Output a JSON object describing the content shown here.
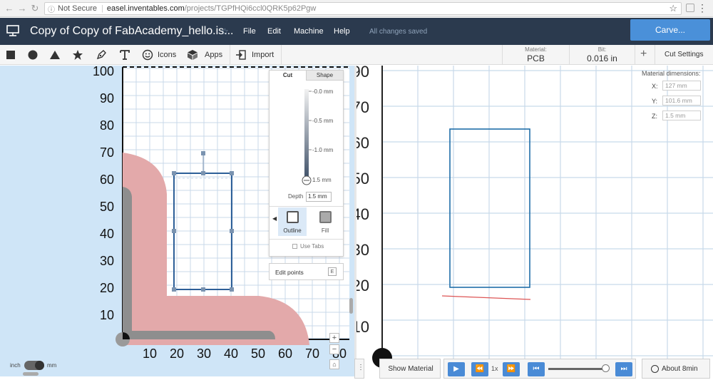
{
  "browser": {
    "security": "Not Secure",
    "host": "easel.inventables.com",
    "path": "/projects/TGPfHQi6ccl0QRK5p62Pgw"
  },
  "app": {
    "title": "Copy of Copy of FabAcademy_hello.is...",
    "menu": [
      "File",
      "Edit",
      "Machine",
      "Help"
    ],
    "save_status": "All changes saved",
    "carve_label": "Carve..."
  },
  "toolbar": {
    "icons_label": "Icons",
    "apps_label": "Apps",
    "import_label": "Import",
    "material_label": "Material:",
    "material_value": "PCB",
    "bit_label": "Bit:",
    "bit_value": "0.016 in",
    "cut_settings_label": "Cut Settings"
  },
  "left_canvas": {
    "y_ticks": [
      "100",
      "90",
      "80",
      "70",
      "60",
      "50",
      "40",
      "30",
      "20",
      "10"
    ],
    "x_ticks": [
      "10",
      "20",
      "30",
      "40",
      "50",
      "60",
      "70",
      "80"
    ],
    "unit_inch": "inch",
    "unit_mm": "mm"
  },
  "cut_panel": {
    "tab_cut": "Cut",
    "tab_shape": "Shape",
    "depth_marks": [
      "-0.0 mm",
      "-0.5 mm",
      "-1.0 mm",
      "1.5 mm"
    ],
    "depth_label": "Depth",
    "depth_value": "1.5 mm",
    "outline_label": "Outline",
    "fill_label": "Fill",
    "use_tabs_label": "Use Tabs",
    "edit_points_label": "Edit points",
    "edit_points_key": "E"
  },
  "right_canvas": {
    "y_ticks": [
      "90",
      "70",
      "60",
      "50",
      "40",
      "30",
      "20",
      "10"
    ],
    "dims_title": "Material dimensions:",
    "dims": [
      {
        "axis": "X:",
        "value": "127 mm"
      },
      {
        "axis": "Y:",
        "value": "101.6 mm"
      },
      {
        "axis": "Z:",
        "value": "1.5 mm"
      }
    ]
  },
  "sim": {
    "show_material": "Show Material",
    "speed": "1x",
    "progress": 0.97,
    "eta": "About 8min"
  },
  "colors": {
    "header_bg": "#2b3a4e",
    "carve_btn": "#4a90d9",
    "canvas_bg": "#cfe5f7",
    "path_fill": "#e3a9aa",
    "toolpath": "#1f6ea8"
  }
}
